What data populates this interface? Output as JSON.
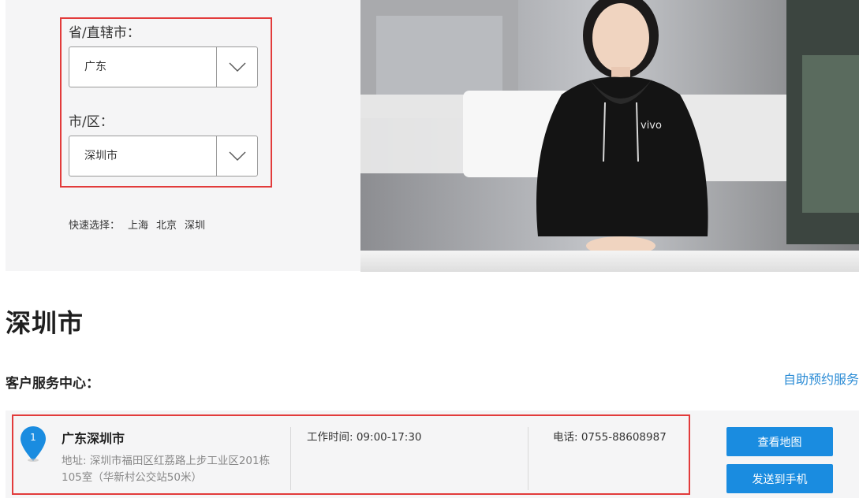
{
  "selector": {
    "province_label": "省/直辖市：",
    "province_value": "广东",
    "city_label": "市/区：",
    "city_value": "深圳市",
    "quick_label": "快速选择：",
    "quick_cities": [
      "上海",
      "北京",
      "深圳"
    ]
  },
  "hero": {
    "brand_logo_text": "vivo"
  },
  "results": {
    "city_title": "深圳市",
    "section_title": "客户服务中心：",
    "self_service_link": "自助预约服务"
  },
  "stores": [
    {
      "index": "1",
      "name": "广东深圳市",
      "address": "地址: 深圳市福田区红荔路上步工业区201栋105室（华新村公交站50米）",
      "hours": "工作时间: 09:00-17:30",
      "phone": "电话: 0755-88608987",
      "map_button": "查看地图",
      "send_button": "发送到手机"
    }
  ],
  "colors": {
    "accent": "#1a8ce0",
    "link": "#2a8bd5",
    "annotation": "#e23b3b",
    "panel_bg": "#f5f5f6"
  },
  "icons": {
    "dropdown": "chevron-down-icon",
    "store_marker": "map-pin-icon"
  }
}
